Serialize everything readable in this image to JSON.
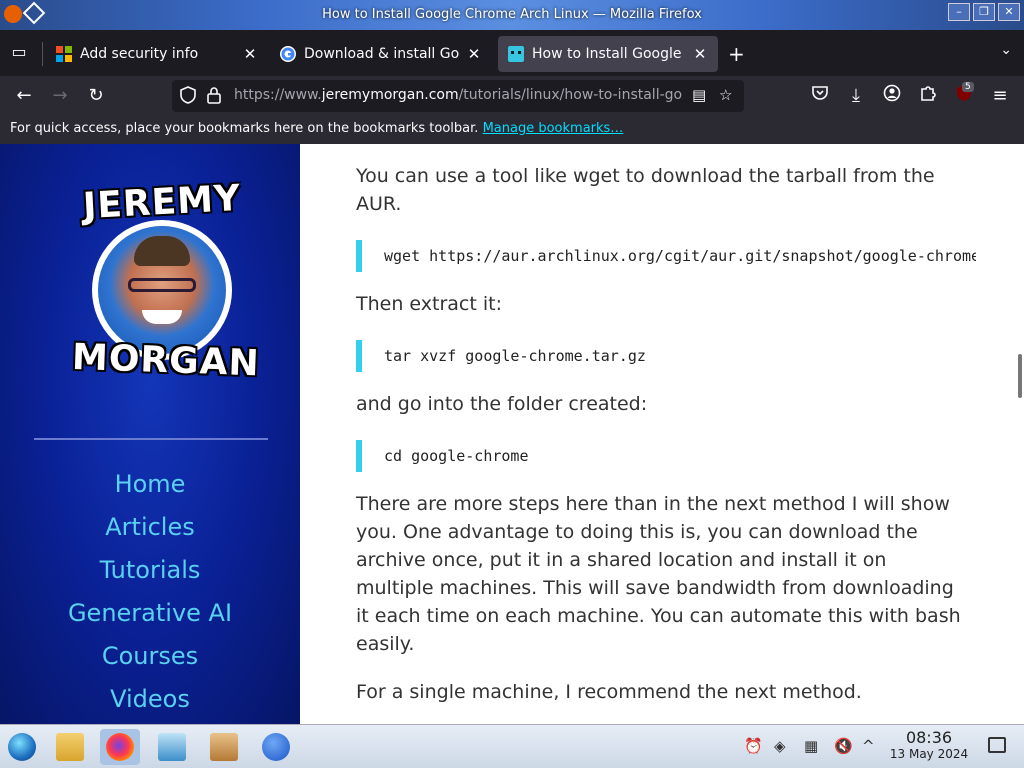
{
  "window": {
    "title": "How to Install Google Chrome Arch Linux — Mozilla Firefox"
  },
  "tabs": [
    {
      "label": "Add security info",
      "icon": "microsoft-icon"
    },
    {
      "label": "Download & install Goog",
      "icon": "google-icon"
    },
    {
      "label": "How to Install Google Ch",
      "icon": "jeremymorgan-favicon"
    }
  ],
  "nav": {
    "url_prefix": "https://www.",
    "url_domain": "jeremymorgan.com",
    "url_path": "/tutorials/linux/how-to-install-go",
    "extensions_badge": "5"
  },
  "bookmarks": {
    "message": "For quick access, place your bookmarks here on the bookmarks toolbar.",
    "link": "Manage bookmarks…"
  },
  "sidebar": {
    "logo_top": "JEREMY",
    "logo_bottom": "MORGAN",
    "menu": [
      "Home",
      "Articles",
      "Tutorials",
      "Generative AI",
      "Courses",
      "Videos"
    ]
  },
  "article": {
    "p1": "You can use a tool like wget to download the tarball from the AUR.",
    "code1": "wget https://aur.archlinux.org/cgit/aur.git/snapshot/google-chrome.tar.gz",
    "p2": "Then extract it:",
    "code2": "tar xvzf google-chrome.tar.gz",
    "p3": "and go into the folder created:",
    "code3": "cd google-chrome",
    "p4": "There are more steps here than in the next method I will show you. One advantage to doing this is, you can download the archive once, put it in a shared location and install it on multiple machines. This will save bandwidth from downloading it each time on each machine. You can automate this with bash easily.",
    "p5": "For a single machine, I recommend the next method."
  },
  "taskbar": {
    "time": "08:36",
    "date": "13 May 2024"
  }
}
